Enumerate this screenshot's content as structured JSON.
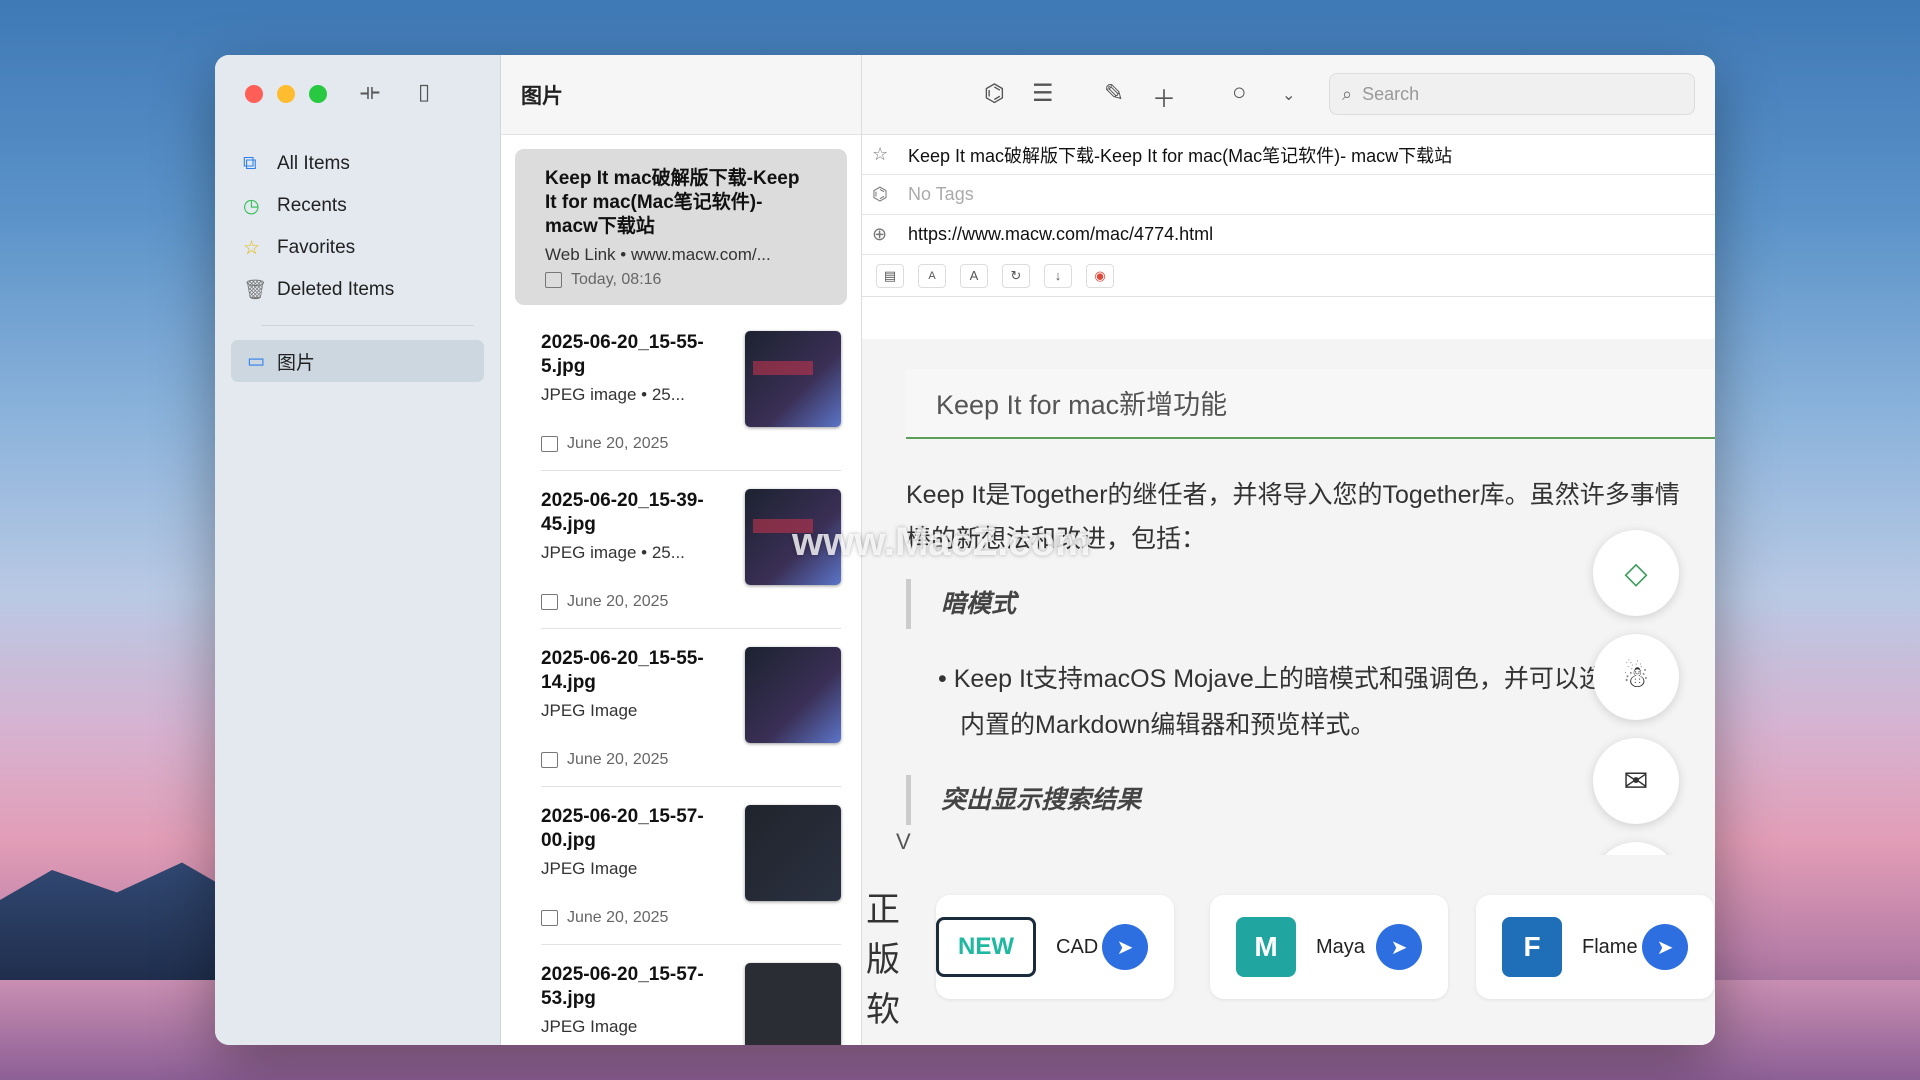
{
  "window": {
    "folder_title": "图片"
  },
  "sidebar": {
    "items": [
      {
        "label": "All Items",
        "icon": "all-items-icon",
        "glyph": "⧉",
        "color": "#2f80ed"
      },
      {
        "label": "Recents",
        "icon": "clock-icon",
        "glyph": "◷",
        "color": "#2fbf52"
      },
      {
        "label": "Favorites",
        "icon": "star-icon",
        "glyph": "☆",
        "color": "#e6b800"
      },
      {
        "label": "Deleted Items",
        "icon": "trash-icon",
        "glyph": "🗑",
        "color": "#777"
      }
    ],
    "folder": "图片"
  },
  "list": [
    {
      "title": "Keep It mac破解版下载-Keep It for mac(Mac笔记软件)- macw下载站",
      "sub": "Web Link • www.macw.com/...",
      "date": "Today, 08:16"
    },
    {
      "title": "2025-06-20_15-55-5.jpg",
      "sub": "JPEG image • 25...",
      "date": "June 20, 2025"
    },
    {
      "title": "2025-06-20_15-39-45.jpg",
      "sub": "JPEG image • 25...",
      "date": "June 20, 2025"
    },
    {
      "title": "2025-06-20_15-55-14.jpg",
      "sub": "JPEG Image",
      "date": "June 20, 2025"
    },
    {
      "title": "2025-06-20_15-57-00.jpg",
      "sub": "JPEG Image",
      "date": "June 20, 2025"
    },
    {
      "title": "2025-06-20_15-57-53.jpg",
      "sub": "JPEG Image",
      "date": ""
    }
  ],
  "toolbar": {
    "search_placeholder": "Search"
  },
  "detail": {
    "title": "Keep It mac破解版下载-Keep It for mac(Mac笔记软件)- macw下载站",
    "tags": "No Tags",
    "url": "https://www.macw.com/mac/4774.html",
    "mini": [
      "A",
      "A"
    ],
    "heading": "Keep It for mac新增功能",
    "para1": "Keep It是Together的继任者，并将导入您的Together库。虽然许多事情",
    "para2": "棒的新想法和改进，包括：",
    "quote1": "暗模式",
    "bullet1": "Keep It支持macOS Mojave上的暗模式和强调色，并可以选择明暗",
    "bullet2": "内置的Markdown编辑器和预览样式。",
    "quote2": "突出显示搜索结果",
    "chevron": "V"
  },
  "ads": {
    "side_text": "正版软",
    "cards": [
      {
        "label": "CAD",
        "logo": "NEW",
        "logo_color": "#ffffff"
      },
      {
        "label": "Maya",
        "logo": "M",
        "logo_color": "#21a5a0"
      },
      {
        "label": "Flame",
        "logo": "F",
        "logo_color": "#1f6fb8"
      }
    ]
  },
  "watermark": "www.MacZ.com"
}
